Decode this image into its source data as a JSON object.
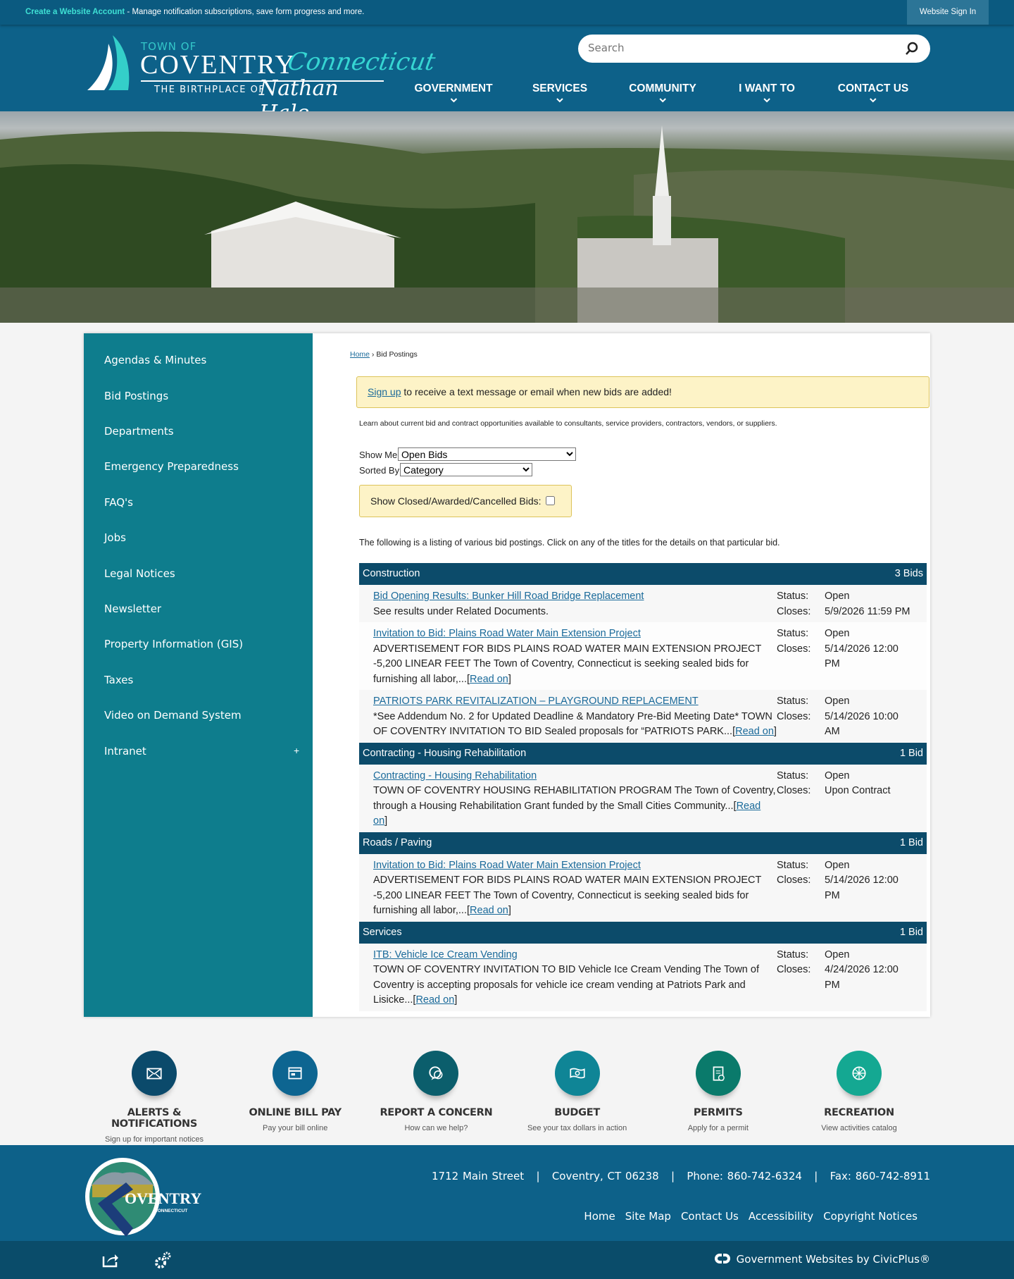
{
  "topbar": {
    "create_account": "Create a Website Account",
    "message": " - Manage notification subscriptions, save form progress and more.",
    "sign_in": "Website Sign In"
  },
  "logo": {
    "town_of": "TOWN OF",
    "name": "COVENTRY",
    "state": "Connecticut",
    "tagline": "THE BIRTHPLACE OF",
    "person": "Nathan Hale"
  },
  "search": {
    "placeholder": "Search"
  },
  "nav": [
    "GOVERNMENT",
    "SERVICES",
    "COMMUNITY",
    "I WANT TO",
    "CONTACT US"
  ],
  "sidebar": {
    "items": [
      "Agendas & Minutes",
      "Bid Postings",
      "Departments",
      "Emergency Preparedness",
      "FAQ's",
      "Jobs",
      "Legal Notices",
      "Newsletter",
      "Property Information (GIS)",
      "Taxes",
      "Video on Demand System",
      "Intranet"
    ],
    "expand": "+"
  },
  "breadcrumb": {
    "home": "Home",
    "sep": " › ",
    "current": "Bid Postings"
  },
  "alert": {
    "link": "Sign up",
    "text": " to receive a text message or email when new bids are added!"
  },
  "intro": "Learn about current bid and contract opportunities available to consultants, service providers, contractors, vendors, or suppliers.",
  "filters": {
    "show_me_label": "Show Me",
    "show_me_value": "Open Bids",
    "sorted_by_label": "Sorted By",
    "sorted_by_value": "Category",
    "closed_label": "Show Closed/Awarded/Cancelled Bids:"
  },
  "listing_text": "The following is a listing of various bid postings. Click on any of the titles for the details on that particular bid.",
  "labels": {
    "status": "Status:",
    "closes": "Closes:",
    "read_on": "Read on"
  },
  "groups": [
    {
      "name": "Construction",
      "count": "3 Bids",
      "bids": [
        {
          "title": "Bid Opening Results: Bunker Hill Road Bridge Replacement",
          "desc": "See results under Related Documents.",
          "status": "Open",
          "closes": "5/9/2026 11:59 PM",
          "read_on": false
        },
        {
          "title": "Invitation to Bid: Plains Road Water Main Extension Project",
          "desc": "ADVERTISEMENT FOR BIDS PLAINS ROAD WATER MAIN EXTENSION PROJECT -5,200 LINEAR FEET The Town of Coventry, Connecticut is seeking sealed bids for furnishing all labor,...",
          "status": "Open",
          "closes": "5/14/2026 12:00 PM",
          "read_on": true
        },
        {
          "title": "PATRIOTS PARK REVITALIZATION – PLAYGROUND REPLACEMENT",
          "desc": "*See Addendum No. 2 for Updated Deadline & Mandatory Pre-Bid Meeting Date* TOWN OF COVENTRY INVITATION TO BID Sealed proposals for “PATRIOTS PARK...",
          "status": "Open",
          "closes": "5/14/2026 10:00 AM",
          "read_on": true
        }
      ]
    },
    {
      "name": "Contracting - Housing Rehabilitation",
      "count": "1 Bid",
      "bids": [
        {
          "title": "Contracting - Housing Rehabilitation",
          "desc": "TOWN OF COVENTRY HOUSING REHABILITATION PROGRAM The Town of Coventry, through a Housing Rehabilitation Grant funded by the Small Cities Community...",
          "status": "Open",
          "closes": "Upon Contract",
          "read_on": true
        }
      ]
    },
    {
      "name": "Roads / Paving",
      "count": "1 Bid",
      "bids": [
        {
          "title": "Invitation to Bid: Plains Road Water Main Extension Project",
          "desc": "ADVERTISEMENT FOR BIDS PLAINS ROAD WATER MAIN EXTENSION PROJECT -5,200 LINEAR FEET The Town of Coventry, Connecticut is seeking sealed bids for furnishing all labor,...",
          "status": "Open",
          "closes": "5/14/2026 12:00 PM",
          "read_on": true
        }
      ]
    },
    {
      "name": "Services",
      "count": "1 Bid",
      "bids": [
        {
          "title": "ITB: Vehicle Ice Cream Vending",
          "desc": "TOWN OF COVENTRY INVITATION TO BID Vehicle Ice Cream Vending The Town of Coventry is accepting proposals for vehicle ice cream vending at Patriots Park and Lisicke...",
          "status": "Open",
          "closes": "4/24/2026 12:00 PM",
          "read_on": true
        }
      ]
    }
  ],
  "quick_links": [
    {
      "title": "ALERTS & NOTIFICATIONS",
      "sub": "Sign up for important notices",
      "icon": "envelope-icon",
      "color": "#0b4a6b"
    },
    {
      "title": "ONLINE BILL PAY",
      "sub": "Pay your bill online",
      "icon": "bill-icon",
      "color": "#0d6591"
    },
    {
      "title": "REPORT A CONCERN",
      "sub": "How can we help?",
      "icon": "chat-icon",
      "color": "#0b5e6c"
    },
    {
      "title": "BUDGET",
      "sub": "See your tax dollars in action",
      "icon": "money-icon",
      "color": "#0f8596"
    },
    {
      "title": "PERMITS",
      "sub": "Apply for a permit",
      "icon": "clipboard-icon",
      "color": "#0a7a6b"
    },
    {
      "title": "RECREATION",
      "sub": "View activities catalog",
      "icon": "ball-icon",
      "color": "#14a892"
    }
  ],
  "footer": {
    "address": "1712 Main Street",
    "city": "Coventry, CT 06238",
    "phone": "Phone: 860-742-6324",
    "fax": "Fax: 860-742-8911",
    "sep": "|",
    "links": [
      "Home",
      "Site Map",
      "Contact Us",
      "Accessibility",
      "Copyright Notices"
    ],
    "logo_text": "COVENTRY",
    "logo_sub": "CONNECTICUT",
    "civicplus": "Government Websites by CivicPlus®"
  },
  "colors": {
    "header": "#0d6189",
    "sidebar": "#0e7d8d",
    "group_header": "#0c4b6a",
    "accent": "#3ee0d4"
  }
}
